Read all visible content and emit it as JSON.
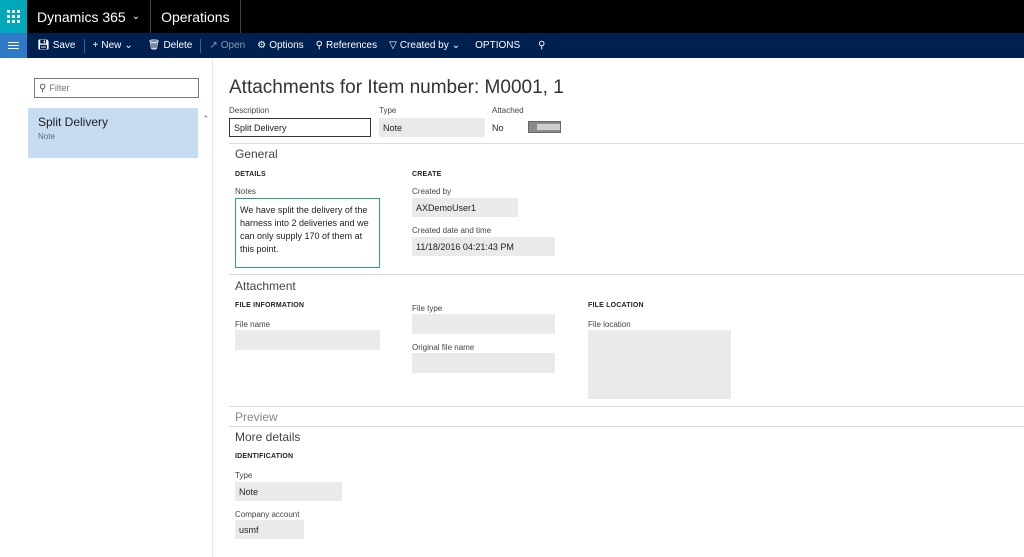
{
  "topbar": {
    "app_name": "Dynamics 365",
    "module_name": "Operations"
  },
  "actionbar": {
    "save": "Save",
    "new": "New",
    "delete": "Delete",
    "open": "Open",
    "options": "Options",
    "references": "References",
    "created_by": "Created by",
    "options_caps": "OPTIONS"
  },
  "leftpane": {
    "filter_placeholder": "Filter",
    "items": [
      {
        "title": "Split Delivery",
        "subtitle": "Note"
      }
    ]
  },
  "main": {
    "title": "Attachments for Item number: M0001, 1",
    "header_fields": {
      "description_label": "Description",
      "description_value": "Split Delivery",
      "type_label": "Type",
      "type_value": "Note",
      "attached_label": "Attached",
      "attached_value": "No"
    },
    "general": {
      "title": "General",
      "details_head": "DETAILS",
      "notes_label": "Notes",
      "notes_value": "We have split the delivery of the harness into 2 deliveries and we can only supply 170 of them at this point.",
      "create_head": "CREATE",
      "created_by_label": "Created by",
      "created_by_value": "AXDemoUser1",
      "created_dt_label": "Created date and time",
      "created_dt_value": "11/18/2016 04:21:43 PM"
    },
    "attachment": {
      "title": "Attachment",
      "file_info_head": "FILE INFORMATION",
      "file_name_label": "File name",
      "file_type_label": "File type",
      "original_file_name_label": "Original file name",
      "file_location_head": "FILE LOCATION",
      "file_location_label": "File location"
    },
    "preview": {
      "title": "Preview"
    },
    "more_details": {
      "title": "More details",
      "identification_head": "IDENTIFICATION",
      "type_label": "Type",
      "type_value": "Note",
      "company_label": "Company account",
      "company_value": "usmf"
    }
  },
  "colors": {
    "topbar": "#000000",
    "waffle": "#00a9b9",
    "actionbar": "#002050",
    "hamburger": "#2f79c7",
    "selected_item": "#c6dcf1",
    "notes_border": "#2d9e8d"
  }
}
